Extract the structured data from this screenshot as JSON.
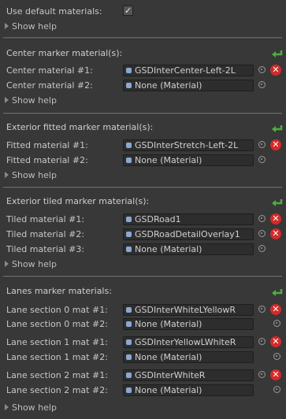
{
  "use_default": {
    "label": "Use default materials:",
    "checked_glyph": "✓"
  },
  "help_label": "Show help",
  "sections": [
    {
      "title": "Center marker material(s):",
      "rows": [
        {
          "label": "Center material #1:",
          "value": "GSDInterCenter-Left-2L"
        },
        {
          "label": "Center material #2:",
          "value": "None (Material)"
        }
      ]
    },
    {
      "title": "Exterior fitted marker material(s):",
      "rows": [
        {
          "label": "Fitted material #1:",
          "value": "GSDInterStretch-Left-2L"
        },
        {
          "label": "Fitted material #2:",
          "value": "None (Material)"
        }
      ]
    },
    {
      "title": "Exterior tiled marker material(s):",
      "rows": [
        {
          "label": "Tiled material #1:",
          "value": "GSDRoad1"
        },
        {
          "label": "Tiled material #2:",
          "value": "GSDRoadDetailOverlay1"
        },
        {
          "label": "Tiled material #3:",
          "value": "None (Material)"
        }
      ]
    },
    {
      "title": "Lanes marker materials:",
      "rows": [
        {
          "label": "Lane section 0 mat #1:",
          "value": "GSDInterWhiteLYellowR"
        },
        {
          "label": "Lane section 0 mat #2:",
          "value": "None (Material)"
        },
        {
          "label": "Lane section 1 mat #1:",
          "value": "GSDInterYellowLWhiteR"
        },
        {
          "label": "Lane section 1 mat #2:",
          "value": "None (Material)"
        },
        {
          "label": "Lane section 2 mat #1:",
          "value": "GSDInterWhiteR"
        },
        {
          "label": "Lane section 2 mat #2:",
          "value": "None (Material)"
        }
      ]
    }
  ],
  "icons": {
    "add": "return-arrow-icon",
    "delete": "delete-x-icon",
    "picker": "object-picker-icon"
  },
  "colors": {
    "background": "#383838",
    "delete": "#d42a2a",
    "add": "#4caf3c"
  }
}
